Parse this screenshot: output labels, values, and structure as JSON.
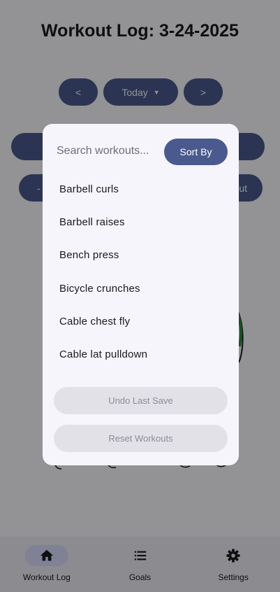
{
  "header": {
    "title": "Workout Log: 3-24-2025"
  },
  "date_nav": {
    "prev_label": "<",
    "date_label": "Today",
    "next_label": ">"
  },
  "row_buttons": {
    "right_partial_label": "ut",
    "left_partial_label": "-"
  },
  "dialog": {
    "search": {
      "placeholder": "Search workouts..."
    },
    "sort_label": "Sort By",
    "workouts": [
      "Barbell curls",
      "Barbell raises",
      "Bench press",
      "Bicycle crunches",
      "Cable chest fly",
      "Cable lat pulldown"
    ],
    "undo_label": "Undo Last Save",
    "reset_label": "Reset Workouts"
  },
  "bottom_nav": {
    "items": [
      {
        "label": "Workout Log",
        "icon": "home-icon",
        "active": true
      },
      {
        "label": "Goals",
        "icon": "list-icon",
        "active": false
      },
      {
        "label": "Settings",
        "icon": "gear-icon",
        "active": false
      }
    ]
  },
  "colors": {
    "primary": "#4a5a8e",
    "active_indicator": "#dbe1ff",
    "disabled": "#e2e1e8"
  }
}
